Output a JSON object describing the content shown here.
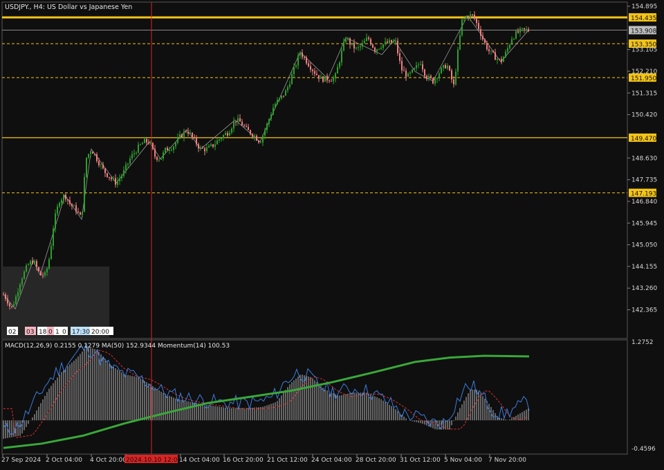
{
  "chart_title": "USDJPY., H4:  US Dollar vs Japanese Yen",
  "indicator_label": "MACD(12,26,9) 0.2155 0.1279 MA(50) 152.9344 Momentum(14) 100.53",
  "price_axis": [
    "154.895",
    "154.435",
    "153.908",
    "153.350",
    "153.105",
    "152.210",
    "151.950",
    "151.315",
    "150.420",
    "149.470",
    "148.630",
    "147.735",
    "147.193",
    "146.840",
    "145.945",
    "145.050",
    "144.155",
    "143.260",
    "142.365"
  ],
  "indicator_axis": [
    "1.2752",
    "-0.4596"
  ],
  "time_axis": [
    "27 Sep 2024",
    "2 Oct 04:00",
    "4 Oct 20:00",
    "2024.10.10 12:00",
    "14 Oct 04:00",
    "16 Oct 20:00",
    "21 Oct 12:00",
    "24 Oct 04:00",
    "28 Oct 20:00",
    "31 Oct 12:00",
    "5 Nov 04:00",
    "7 Nov 20:00"
  ],
  "levels": {
    "solid_top": "154.435",
    "current": "153.908",
    "dashed_1": "153.350",
    "dashed_2": "151.950",
    "solid_mid": "149.470",
    "dashed_3": "147.193"
  },
  "mini_panel_labels": [
    "02",
    "03",
    "18",
    "0",
    "1",
    "0",
    "17:30",
    "20:00"
  ],
  "colors": {
    "background": "#0f0f0f",
    "bull": "#2ca02c",
    "bear": "#f08080",
    "level_yellow": "#f5c518",
    "macd_signal": "#e03030",
    "macd_line": "#3b7ddd",
    "ma50": "#3aa83a",
    "cursor_red": "#d22"
  }
}
